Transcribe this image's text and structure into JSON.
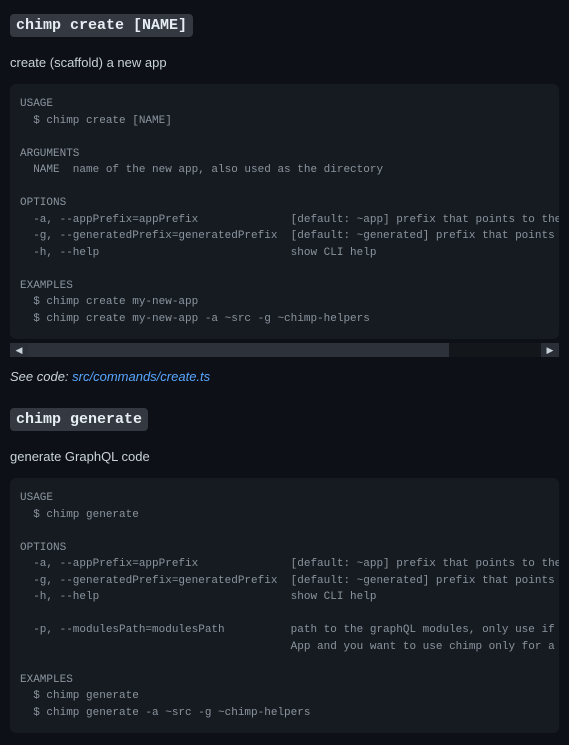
{
  "sections": [
    {
      "heading": "chimp create [NAME]",
      "description": "create (scaffold) a new app",
      "code": "USAGE\n  $ chimp create [NAME]\n\nARGUMENTS\n  NAME  name of the new app, also used as the directory\n\nOPTIONS\n  -a, --appPrefix=appPrefix              [default: ~app] prefix that points to the sourcecode of your app\n  -g, --generatedPrefix=generatedPrefix  [default: ~generated] prefix that points to the generated by chimp h\n  -h, --help                             show CLI help\n\nEXAMPLES\n  $ chimp create my-new-app\n  $ chimp create my-new-app -a ~src -g ~chimp-helpers",
      "hasScrollbar": true,
      "seeCode": {
        "label": "See code: ",
        "link": "src/commands/create.ts"
      }
    },
    {
      "heading": "chimp generate",
      "description": "generate GraphQL code",
      "code": "USAGE\n  $ chimp generate\n\nOPTIONS\n  -a, --appPrefix=appPrefix              [default: ~app] prefix that points to the sourcecode of your app\n  -g, --generatedPrefix=generatedPrefix  [default: ~generated] prefix that points to the generated by chimp h\n  -h, --help                             show CLI help\n\n  -p, --modulesPath=modulesPath          path to the graphQL modules, only use if you are migrating an existi\n                                         App and you want to use chimp only for a part of it\n\nEXAMPLES\n  $ chimp generate\n  $ chimp generate -a ~src -g ~chimp-helpers",
      "hasScrollbar": false,
      "seeCode": null
    }
  ],
  "scrollbar": {
    "leftArrow": "◀",
    "rightArrow": "▶"
  }
}
